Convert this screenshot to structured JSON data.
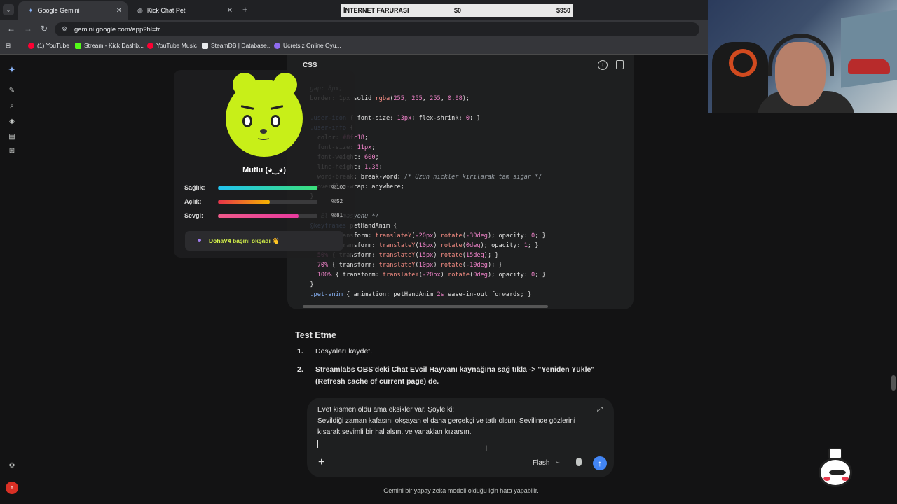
{
  "browser": {
    "tabs": [
      {
        "title": "Google Gemini"
      },
      {
        "title": "Kick Chat Pet"
      }
    ],
    "url": "gemini.google.com/app?hl=tr",
    "bookmarks": [
      "(1) YouTube",
      "Stream - Kick Dashb...",
      "YouTube Music",
      "SteamDB | Database...",
      "Ücretsiz Online Oyu..."
    ]
  },
  "overlay_bar": {
    "title": "İNTERNET FARURASI",
    "current": "$0",
    "goal": "$950"
  },
  "pet": {
    "mood": "Mutlu (◕‿◕)",
    "stats": [
      {
        "label": "Sağlık:",
        "value": "%100",
        "fraction": 1.0,
        "gradient": "linear-gradient(90deg,#22c3f0,#3be07a)"
      },
      {
        "label": "Açlık:",
        "value": "%52",
        "fraction": 0.52,
        "gradient": "linear-gradient(90deg,#e8324a,#f4b400)"
      },
      {
        "label": "Sevgi:",
        "value": "%81",
        "fraction": 0.81,
        "gradient": "linear-gradient(90deg,#f05a8a,#e83a9e)"
      }
    ],
    "notice": "DohaV4 başını okşadı 👋"
  },
  "code": {
    "lang": "CSS"
  },
  "response": {
    "title": "Test Etme",
    "steps": [
      {
        "num": "1.",
        "text": "Dosyaları kaydet."
      },
      {
        "num": "2.",
        "text": "Streamlabs OBS'deki Chat Evcil Hayvanı kaynağına sağ tıkla -> \"Yeniden Yükle\" (Refresh cache of current page) de."
      }
    ]
  },
  "input": {
    "text": "Evet kısmen oldu ama eksikler var. Şöyle ki:\nSevildiği zaman kafasını okşayan el daha gerçekçi ve tatlı olsun. Sevilince gözlerini kısarak sevimli bir hal alsın. ve yanakları kızarsın.",
    "model": "Flash"
  },
  "disclaimer": "Gemini bir yapay zeka modeli olduğu için hata yapabilir.",
  "colors": {
    "accent": "#4285f4",
    "pet_face": "#c8ef18"
  }
}
